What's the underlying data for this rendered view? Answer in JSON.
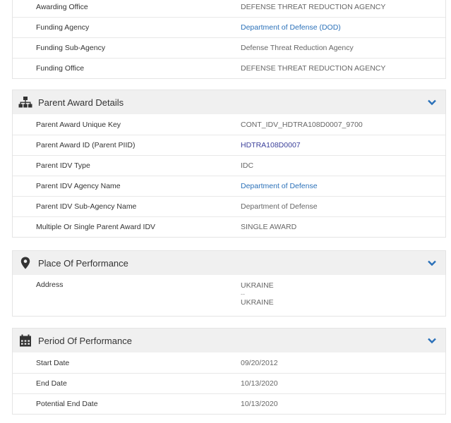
{
  "top_section": {
    "rows": [
      {
        "label": "Awarding Office",
        "value": "DEFENSE THREAT REDUCTION AGENCY",
        "link": false
      },
      {
        "label": "Funding Agency",
        "value": "Department of Defense (DOD)",
        "link": true
      },
      {
        "label": "Funding Sub-Agency",
        "value": "Defense Threat Reduction Agency",
        "link": false
      },
      {
        "label": "Funding Office",
        "value": "DEFENSE THREAT REDUCTION AGENCY",
        "link": false
      }
    ]
  },
  "parent_award": {
    "title": "Parent Award Details",
    "icon": "hierarchy-icon",
    "rows": [
      {
        "label": "Parent Award Unique Key",
        "value": "CONT_IDV_HDTRA108D0007_9700",
        "link": false
      },
      {
        "label": "Parent Award ID (Parent PIID)",
        "value": "HDTRA108D0007",
        "link": true
      },
      {
        "label": "Parent IDV Type",
        "value": "IDC",
        "link": false
      },
      {
        "label": "Parent IDV Agency Name",
        "value": "Department of Defense",
        "link": true
      },
      {
        "label": "Parent IDV Sub-Agency Name",
        "value": "Department of Defense",
        "link": false
      },
      {
        "label": "Multiple Or Single Parent Award IDV",
        "value": "SINGLE AWARD",
        "link": false
      }
    ]
  },
  "place_of_performance": {
    "title": "Place Of Performance",
    "icon": "map-marker-icon",
    "address_label": "Address",
    "address_line1": "UKRAINE",
    "address_sep": "--",
    "address_line2": "UKRAINE"
  },
  "period_of_performance": {
    "title": "Period Of Performance",
    "icon": "calendar-icon",
    "rows": [
      {
        "label": "Start Date",
        "value": "09/20/2012",
        "link": false
      },
      {
        "label": "End Date",
        "value": "10/13/2020",
        "link": false
      },
      {
        "label": "Potential End Date",
        "value": "10/13/2020",
        "link": false
      }
    ]
  },
  "colors": {
    "link": "#2b71b9",
    "header_bg": "#f0f0f0",
    "chevron": "#2b71b9"
  }
}
